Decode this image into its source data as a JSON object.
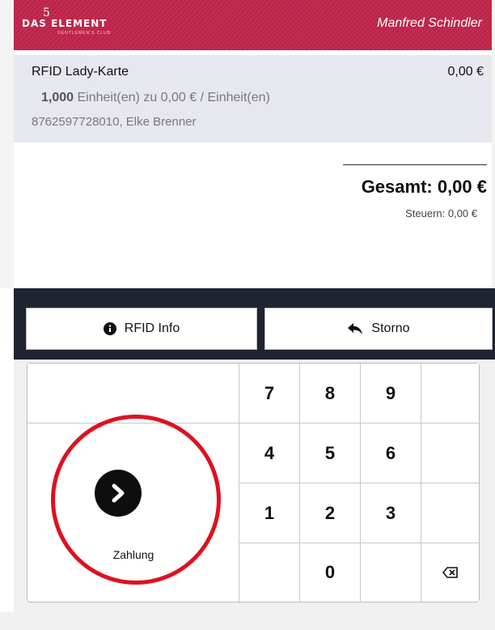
{
  "header": {
    "logo_text": "DAS  ELEMENT",
    "logo_sub": "GENTLEMEN'S CLUB",
    "logo_number": "5",
    "user_name": "Manfred Schindler",
    "brand_color": "#c0234a"
  },
  "order": {
    "product_name": "RFID Lady-Karte",
    "price": "0,00 €",
    "quantity": "1,000",
    "unit_text": "Einheit(en) zu 0,00 € / Einheit(en)",
    "note": "8762597728010, Elke Brenner"
  },
  "totals": {
    "total": "Gesamt: 0,00 €",
    "tax": "Steuern: 0,00 €"
  },
  "actions": {
    "rfid_info": "RFID Info",
    "rfid_icon": "info-circle-icon",
    "storno": "Storno",
    "storno_icon": "reply-arrow-icon"
  },
  "keypad": {
    "keys": [
      "7",
      "8",
      "9",
      "4",
      "5",
      "6",
      "1",
      "2",
      "3",
      "0"
    ],
    "backspace_icon": "backspace-icon",
    "pay_label": "Zahlung",
    "pay_icon": "chevron-right-icon"
  },
  "colors": {
    "action_bar": "#1e2530",
    "highlight_ring": "#e01020",
    "order_line_bg": "#e7e8ef"
  }
}
